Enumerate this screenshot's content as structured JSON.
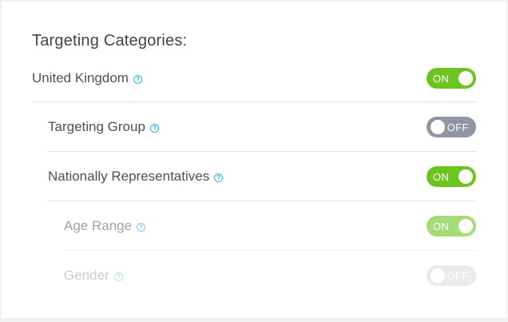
{
  "panel": {
    "heading": "Targeting Categories:"
  },
  "rows": [
    {
      "label": "United Kingdom",
      "toggle_state": "ON",
      "help_icon": "question-circle-icon"
    },
    {
      "label": "Targeting Group",
      "toggle_state": "OFF",
      "help_icon": "question-circle-icon"
    },
    {
      "label": "Nationally Representatives",
      "toggle_state": "ON",
      "help_icon": "question-circle-icon"
    },
    {
      "label": "Age Range",
      "toggle_state": "ON",
      "help_icon": "question-circle-icon"
    },
    {
      "label": "Gender",
      "toggle_state": "OFF",
      "help_icon": "question-circle-icon"
    }
  ],
  "colors": {
    "toggle_on": "#6bc51e",
    "toggle_off": "#8f96a1",
    "help_icon": "#25b4e3",
    "text": "#4b5058"
  }
}
